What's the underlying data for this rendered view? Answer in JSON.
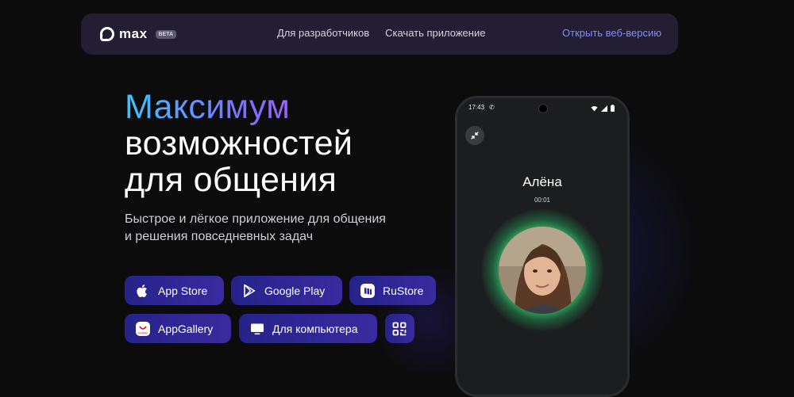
{
  "nav": {
    "logo_text": "max",
    "beta_badge": "BETA",
    "links": [
      "Для разработчиков",
      "Скачать приложение"
    ],
    "web_version": "Открыть веб-версию"
  },
  "hero": {
    "title_highlight": "Максимум",
    "title_line2": "возможностей",
    "title_line3": "для общения",
    "subtitle_line1": "Быстрое и лёгкое приложение для общения",
    "subtitle_line2": "и решения повседневных задач"
  },
  "downloads": {
    "app_store": "App Store",
    "google_play": "Google Play",
    "rustore": "RuStore",
    "app_gallery": "AppGallery",
    "desktop": "Для компьютера"
  },
  "phone": {
    "status_time": "17:43",
    "caller_name": "Алёна",
    "call_duration": "00:01"
  },
  "colors": {
    "background": "#0c0c0d",
    "nav_bg": "#231e33",
    "button_bg": "#2a2790",
    "accent_link": "#7f8dff",
    "call_glow": "#3ce678"
  }
}
